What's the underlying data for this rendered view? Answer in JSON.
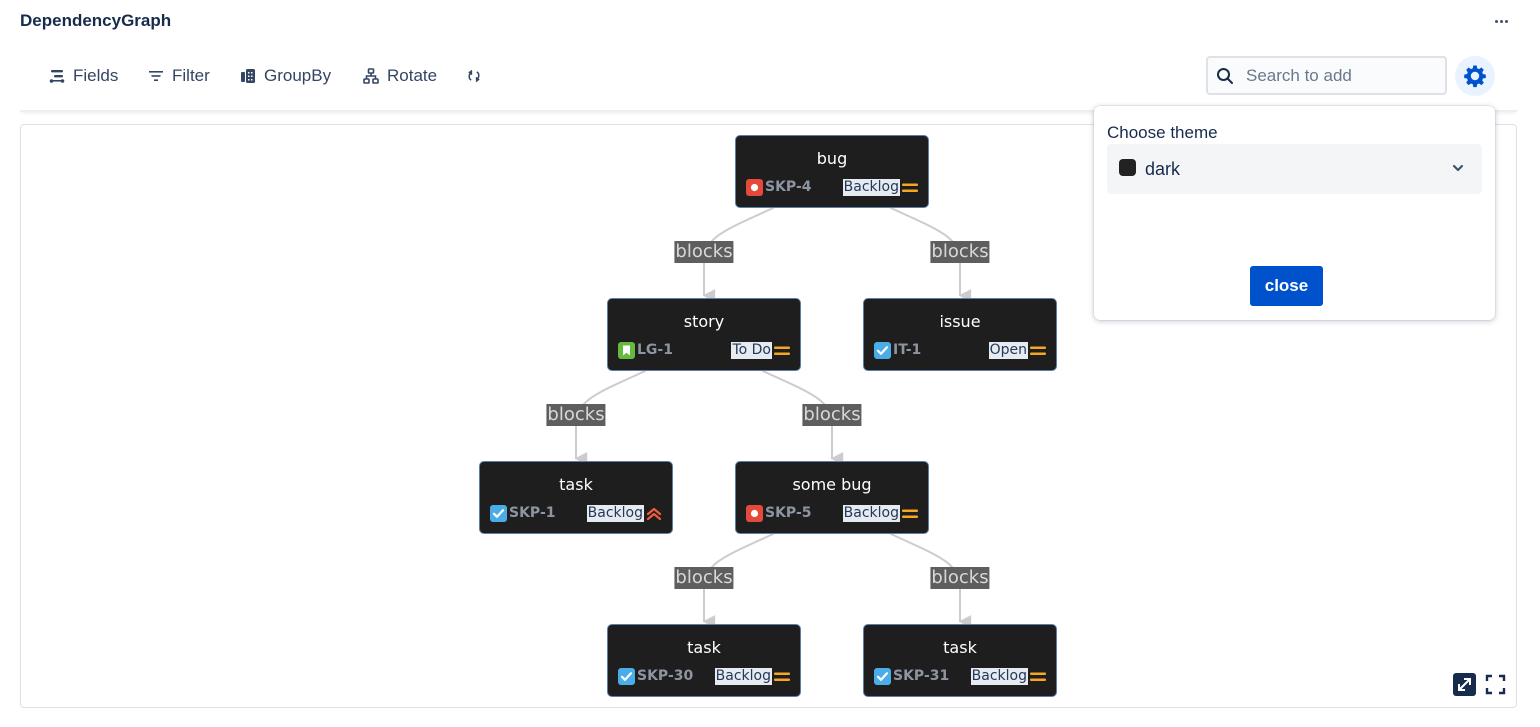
{
  "app": {
    "title": "DependencyGraph",
    "more_icon": "more-horizontal-icon"
  },
  "toolbar": {
    "fields_label": "Fields",
    "filter_label": "Filter",
    "groupby_label": "GroupBy",
    "rotate_label": "Rotate",
    "refresh_icon": "refresh-icon"
  },
  "search": {
    "placeholder": "Search to add",
    "value": ""
  },
  "settings": {
    "icon": "gear-icon"
  },
  "theme_popup": {
    "label": "Choose theme",
    "selected": "dark",
    "swatch_color": "#222222",
    "close_label": "close"
  },
  "colors": {
    "accent": "#0052cc",
    "node_bg": "#1e1e1e",
    "edge": "#cccccc",
    "edge_label_bg": "#5e5e5e",
    "bug": "#e5493a",
    "story": "#63ba3c",
    "task": "#4bade8",
    "priority_medium": "#f5a623",
    "priority_high": "#f15b40"
  },
  "graph": {
    "nodes": [
      {
        "id": "n1",
        "title": "bug",
        "key": "SKP-4",
        "type": "bug",
        "status": "Backlog",
        "priority": "medium"
      },
      {
        "id": "n2",
        "title": "story",
        "key": "LG-1",
        "type": "story",
        "status": "To Do",
        "priority": "medium"
      },
      {
        "id": "n3",
        "title": "issue",
        "key": "IT-1",
        "type": "task",
        "status": "Open",
        "priority": "medium"
      },
      {
        "id": "n4",
        "title": "task",
        "key": "SKP-1",
        "type": "task",
        "status": "Backlog",
        "priority": "high"
      },
      {
        "id": "n5",
        "title": "some bug",
        "key": "SKP-5",
        "type": "bug",
        "status": "Backlog",
        "priority": "medium"
      },
      {
        "id": "n6",
        "title": "task",
        "key": "SKP-30",
        "type": "task",
        "status": "Backlog",
        "priority": "medium"
      },
      {
        "id": "n7",
        "title": "task",
        "key": "SKP-31",
        "type": "task",
        "status": "Backlog",
        "priority": "medium"
      }
    ],
    "edges": [
      {
        "from": "n1",
        "to": "n2",
        "label": "blocks"
      },
      {
        "from": "n1",
        "to": "n3",
        "label": "blocks"
      },
      {
        "from": "n2",
        "to": "n4",
        "label": "blocks"
      },
      {
        "from": "n2",
        "to": "n5",
        "label": "blocks"
      },
      {
        "from": "n5",
        "to": "n6",
        "label": "blocks"
      },
      {
        "from": "n5",
        "to": "n7",
        "label": "blocks"
      }
    ]
  },
  "canvas_controls": {
    "fit_icon": "fit-to-screen-icon",
    "fullscreen_icon": "fullscreen-icon"
  }
}
